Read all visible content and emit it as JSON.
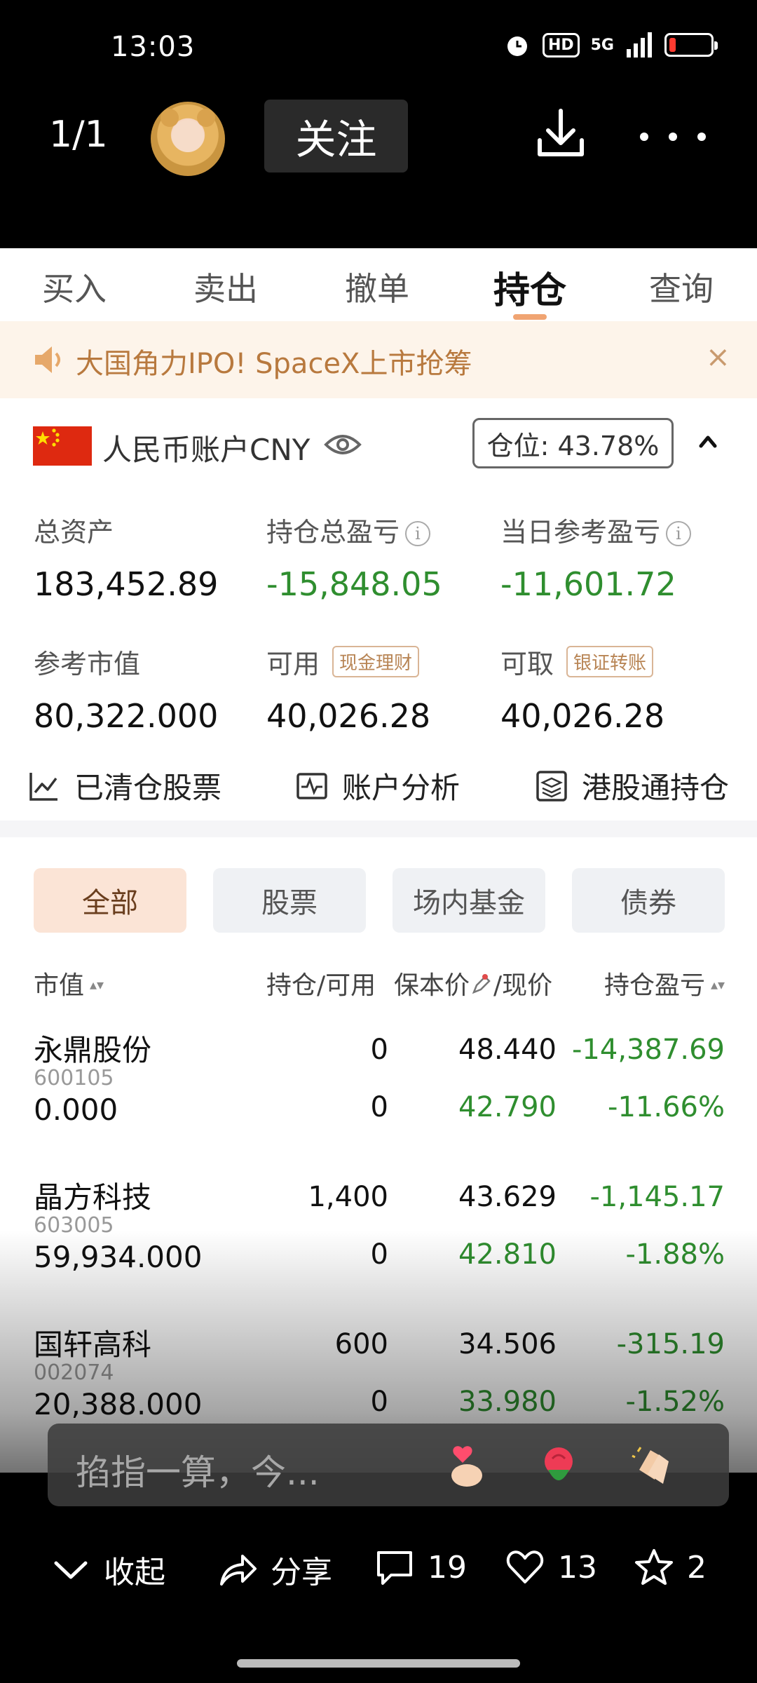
{
  "status_bar": {
    "time": "13:03",
    "hd": "HD",
    "network": "5G"
  },
  "viewer": {
    "page_counter": "1/1",
    "follow_label": "关注"
  },
  "tabs": [
    {
      "label": "买入"
    },
    {
      "label": "卖出"
    },
    {
      "label": "撤单"
    },
    {
      "label": "持仓"
    },
    {
      "label": "查询"
    }
  ],
  "active_tab": "持仓",
  "banner": {
    "text": "大国角力IPO! SpaceX上市抢筹",
    "close": "×"
  },
  "account": {
    "label": "人民币账户CNY",
    "position_ratio": "仓位: 43.78%"
  },
  "stats": {
    "total_assets": {
      "label": "总资产",
      "value": "183,452.89"
    },
    "holding_pnl": {
      "label": "持仓总盈亏",
      "value": "-15,848.05"
    },
    "daily_pnl": {
      "label": "当日参考盈亏",
      "value": "-11,601.72"
    },
    "market_value": {
      "label": "参考市值",
      "value": "80,322.000"
    },
    "available": {
      "label": "可用",
      "tag": "现金理财",
      "value": "40,026.28"
    },
    "withdrawable": {
      "label": "可取",
      "tag": "银证转账",
      "value": "40,026.28"
    }
  },
  "quick_actions": [
    {
      "label": "已清仓股票"
    },
    {
      "label": "账户分析"
    },
    {
      "label": "港股通持仓"
    }
  ],
  "filters": [
    {
      "label": "全部"
    },
    {
      "label": "股票"
    },
    {
      "label": "场内基金"
    },
    {
      "label": "债券"
    }
  ],
  "table": {
    "headers": {
      "market_value": "市值",
      "holding_available": "持仓/可用",
      "cost_current": "保本价",
      "cost_current_suffix": "/现价",
      "pnl": "持仓盈亏"
    },
    "rows": [
      {
        "name": "永鼎股份",
        "code": "600105",
        "market_value": "0.000",
        "holding": "0",
        "available": "0",
        "cost": "48.440",
        "price": "42.790",
        "pnl": "-14,387.69",
        "pnl_pct": "-11.66%"
      },
      {
        "name": "晶方科技",
        "code": "603005",
        "market_value": "59,934.000",
        "holding": "1,400",
        "available": "0",
        "cost": "43.629",
        "price": "42.810",
        "pnl": "-1,145.17",
        "pnl_pct": "-1.88%"
      },
      {
        "name": "国轩高科",
        "code": "002074",
        "market_value": "20,388.000",
        "holding": "600",
        "available": "0",
        "cost": "34.506",
        "price": "33.980",
        "pnl": "-315.19",
        "pnl_pct": "-1.52%"
      }
    ]
  },
  "comment": {
    "placeholder": "掐指一算，今..."
  },
  "bottom_bar": {
    "collapse": "收起",
    "share": "分享",
    "comments": "19",
    "likes": "13",
    "favorites": "2"
  },
  "colors": {
    "accent": "#f0a472",
    "loss_green": "#2f8e2f",
    "banner_text": "#b8793e"
  }
}
